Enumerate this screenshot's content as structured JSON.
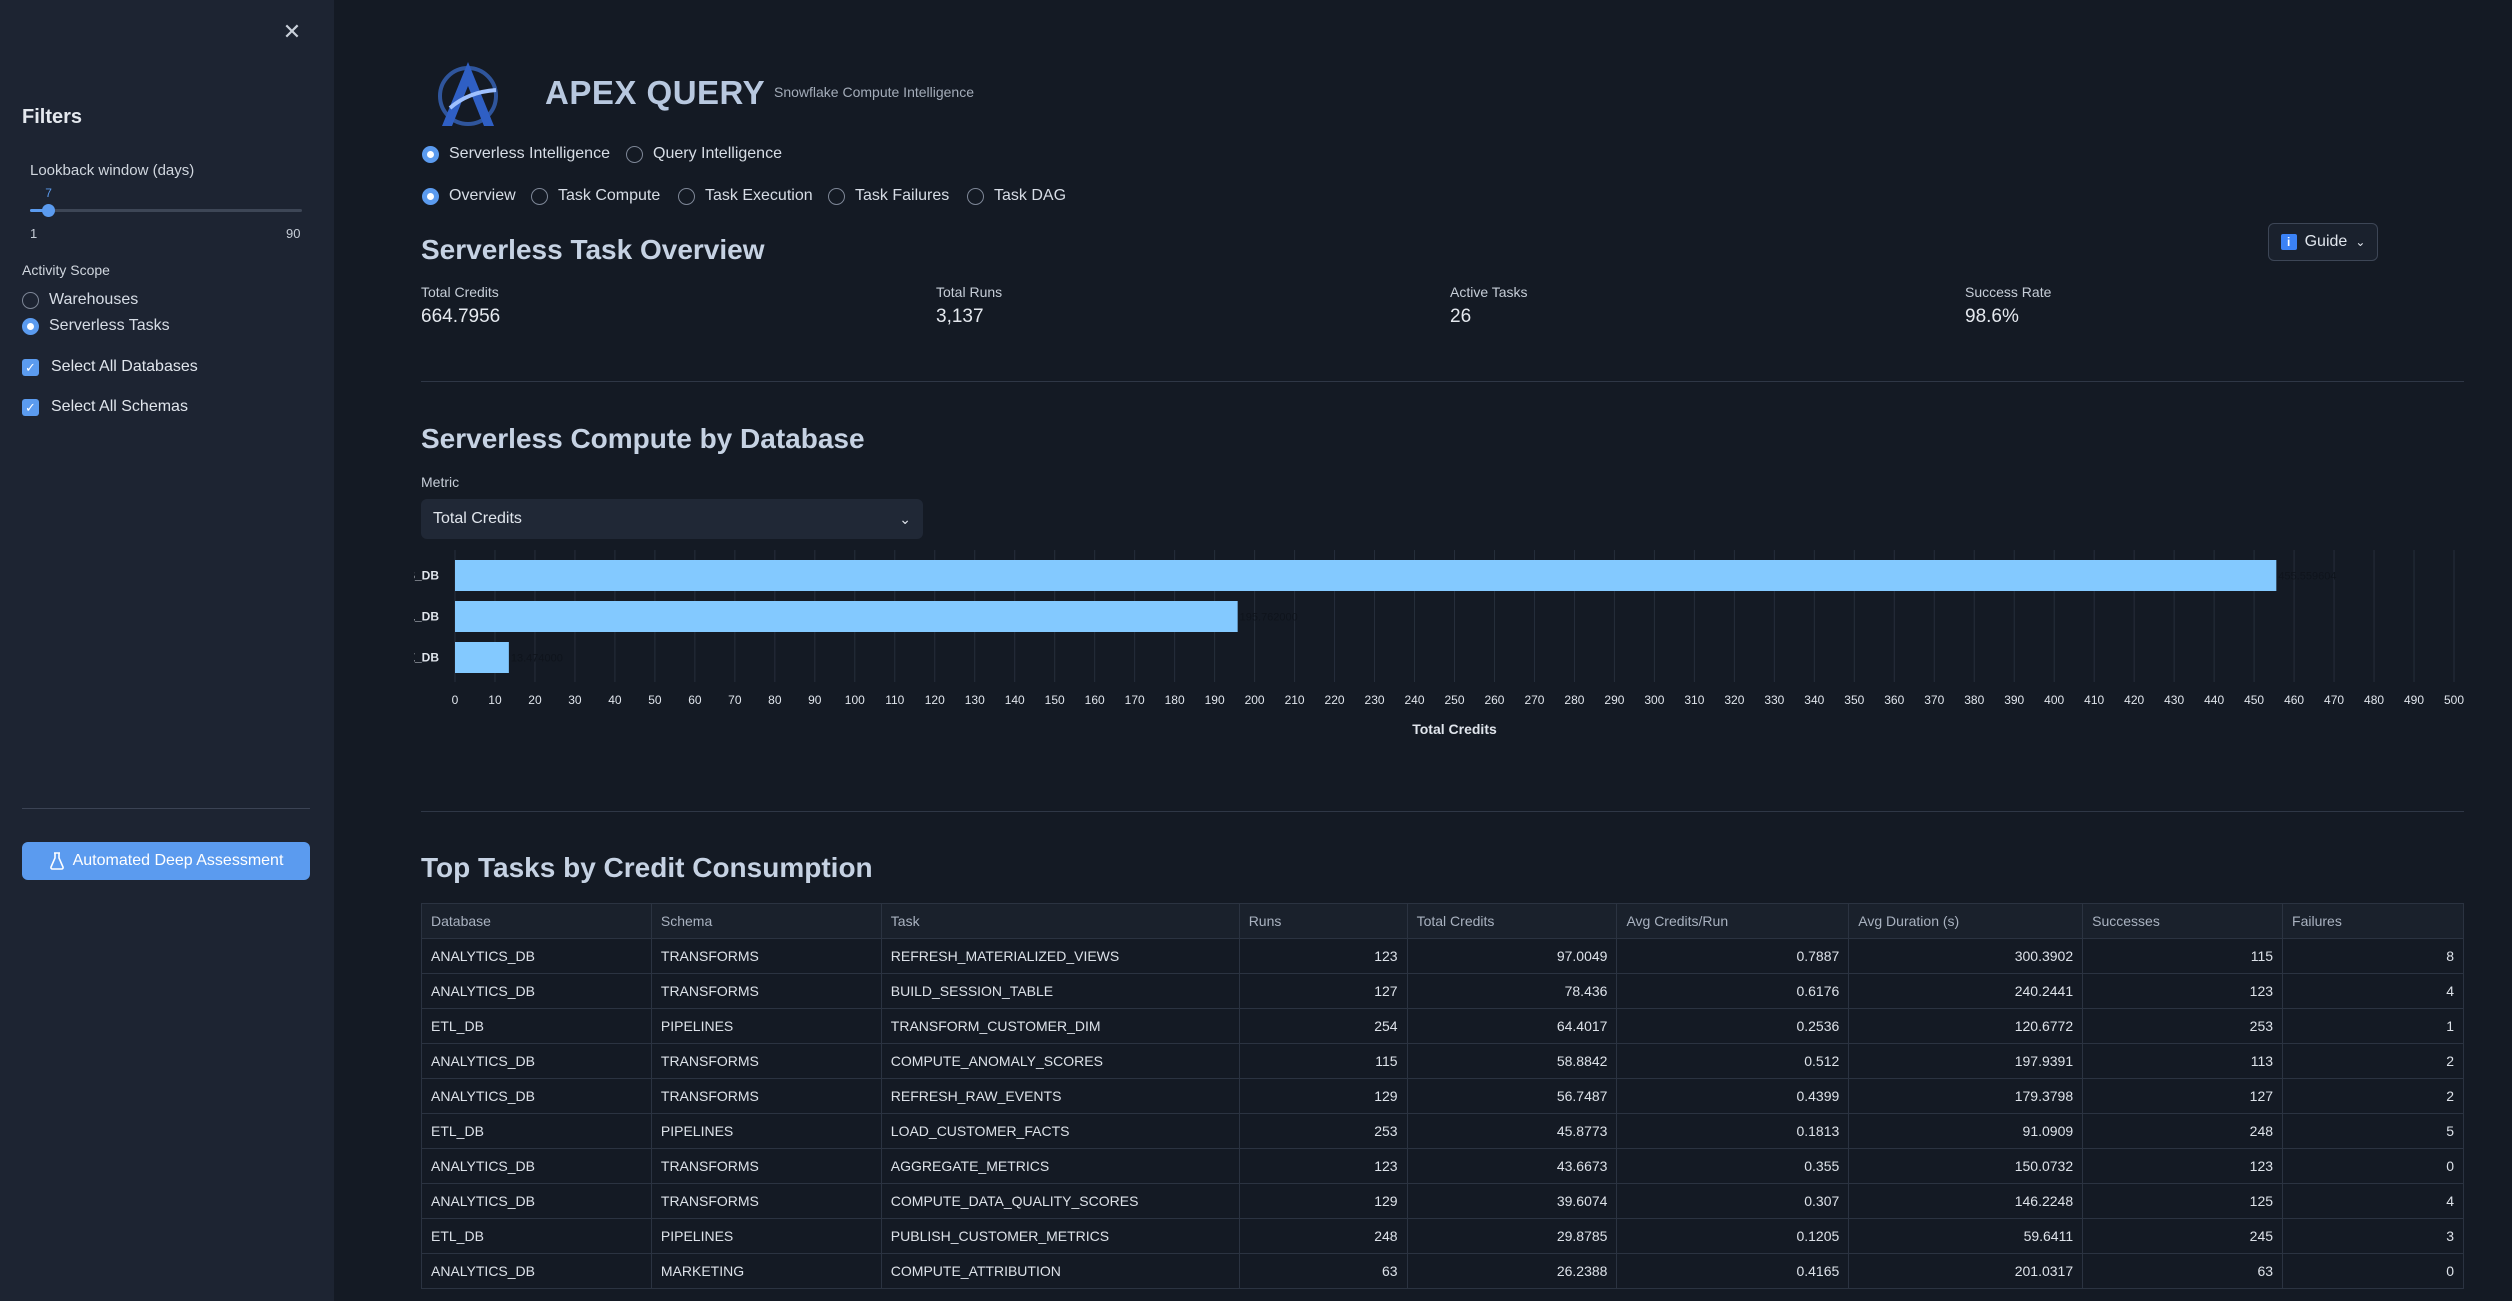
{
  "sidebar": {
    "title": "Filters",
    "lookback": {
      "label": "Lookback window (days)",
      "value": "7",
      "min": "1",
      "max": "90",
      "fraction": 0.067
    },
    "scope": {
      "label": "Activity Scope",
      "options": [
        {
          "label": "Warehouses",
          "selected": false
        },
        {
          "label": "Serverless Tasks",
          "selected": true
        }
      ]
    },
    "select_all_databases": "Select All Databases",
    "select_all_schemas": "Select All Schemas",
    "deep_assessment": "Automated Deep Assessment"
  },
  "header": {
    "title": "APEX QUERY",
    "subtitle": "Snowflake Compute Intelligence"
  },
  "mode_tabs": [
    {
      "label": "Serverless Intelligence",
      "selected": true
    },
    {
      "label": "Query Intelligence",
      "selected": false
    }
  ],
  "sub_tabs": [
    {
      "label": "Overview",
      "selected": true
    },
    {
      "label": "Task Compute",
      "selected": false
    },
    {
      "label": "Task Execution",
      "selected": false
    },
    {
      "label": "Task Failures",
      "selected": false
    },
    {
      "label": "Task DAG",
      "selected": false
    }
  ],
  "overview": {
    "title": "Serverless Task Overview",
    "guide_label": "Guide",
    "metrics": [
      {
        "label": "Total Credits",
        "value": "664.7956"
      },
      {
        "label": "Total Runs",
        "value": "3,137"
      },
      {
        "label": "Active Tasks",
        "value": "26"
      },
      {
        "label": "Success Rate",
        "value": "98.6%"
      }
    ]
  },
  "compute": {
    "title": "Serverless Compute by Database",
    "metric_label": "Metric",
    "metric_selected": "Total Credits"
  },
  "chart_data": {
    "type": "bar",
    "orientation": "horizontal",
    "categories": [
      "ANALYTICS_DB",
      "ETL_DB",
      "COMPLIANCE_DB"
    ],
    "values": [
      455.559604,
      195.762,
      13.474
    ],
    "value_labels": [
      "455.559604",
      "195.762000",
      "13.474000"
    ],
    "xlabel": "Total Credits",
    "xlim": [
      0,
      500
    ],
    "xtick_step": 10,
    "grid": true,
    "bar_color": "#83c9ff"
  },
  "top_tasks": {
    "title": "Top Tasks by Credit Consumption",
    "columns": [
      "Database",
      "Schema",
      "Task",
      "Runs",
      "Total Credits",
      "Avg Credits/Run",
      "Avg Duration (s)",
      "Successes",
      "Failures"
    ],
    "rows": [
      [
        "ANALYTICS_DB",
        "TRANSFORMS",
        "REFRESH_MATERIALIZED_VIEWS",
        "123",
        "97.0049",
        "0.7887",
        "300.3902",
        "115",
        "8"
      ],
      [
        "ANALYTICS_DB",
        "TRANSFORMS",
        "BUILD_SESSION_TABLE",
        "127",
        "78.436",
        "0.6176",
        "240.2441",
        "123",
        "4"
      ],
      [
        "ETL_DB",
        "PIPELINES",
        "TRANSFORM_CUSTOMER_DIM",
        "254",
        "64.4017",
        "0.2536",
        "120.6772",
        "253",
        "1"
      ],
      [
        "ANALYTICS_DB",
        "TRANSFORMS",
        "COMPUTE_ANOMALY_SCORES",
        "115",
        "58.8842",
        "0.512",
        "197.9391",
        "113",
        "2"
      ],
      [
        "ANALYTICS_DB",
        "TRANSFORMS",
        "REFRESH_RAW_EVENTS",
        "129",
        "56.7487",
        "0.4399",
        "179.3798",
        "127",
        "2"
      ],
      [
        "ETL_DB",
        "PIPELINES",
        "LOAD_CUSTOMER_FACTS",
        "253",
        "45.8773",
        "0.1813",
        "91.0909",
        "248",
        "5"
      ],
      [
        "ANALYTICS_DB",
        "TRANSFORMS",
        "AGGREGATE_METRICS",
        "123",
        "43.6673",
        "0.355",
        "150.0732",
        "123",
        "0"
      ],
      [
        "ANALYTICS_DB",
        "TRANSFORMS",
        "COMPUTE_DATA_QUALITY_SCORES",
        "129",
        "39.6074",
        "0.307",
        "146.2248",
        "125",
        "4"
      ],
      [
        "ETL_DB",
        "PIPELINES",
        "PUBLISH_CUSTOMER_METRICS",
        "248",
        "29.8785",
        "0.1205",
        "59.6411",
        "245",
        "3"
      ],
      [
        "ANALYTICS_DB",
        "MARKETING",
        "COMPUTE_ATTRIBUTION",
        "63",
        "26.2388",
        "0.4165",
        "201.0317",
        "63",
        "0"
      ]
    ]
  },
  "colors": {
    "accent": "#5b9bef",
    "bar": "#83c9ff",
    "background": "#141a24",
    "sidebar": "#1d2432"
  }
}
